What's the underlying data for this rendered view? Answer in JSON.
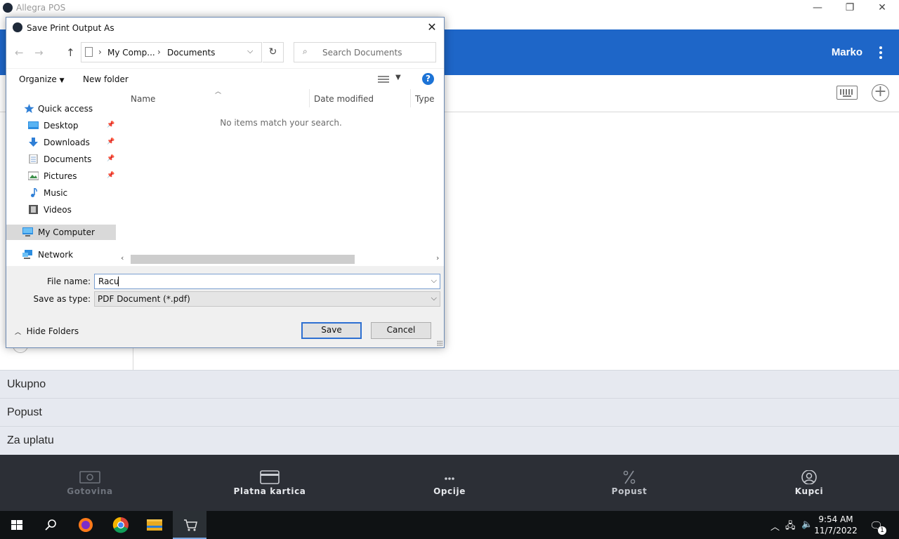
{
  "app": {
    "title": "Allegra POS",
    "user": "Marko",
    "totals": [
      {
        "label": "Ukupno"
      },
      {
        "label": "Popust"
      },
      {
        "label": "Za uplatu"
      }
    ],
    "bottom_actions": [
      {
        "label": "Gotovina",
        "icon": "cash-icon",
        "enabled": false
      },
      {
        "label": "Platna kartica",
        "icon": "card-icon",
        "enabled": true
      },
      {
        "label": "Opcije",
        "icon": "more-icon",
        "enabled": true
      },
      {
        "label": "Popust",
        "icon": "percent-icon",
        "enabled": false
      },
      {
        "label": "Kupci",
        "icon": "user-icon",
        "enabled": true
      }
    ],
    "colors": {
      "header": "#1e66c8",
      "bottom_bar": "#2c2f36",
      "totals_bg": "#e6e9f0"
    }
  },
  "dialog": {
    "title": "Save Print Output As",
    "address": {
      "segments": [
        "My Comp...",
        "Documents"
      ]
    },
    "search_placeholder": "Search Documents",
    "commands": {
      "organize": "Organize",
      "new_folder": "New folder"
    },
    "nav_tree": [
      {
        "label": "Quick access",
        "icon": "star-icon",
        "pinned": false
      },
      {
        "label": "Desktop",
        "icon": "desktop-icon",
        "pinned": true
      },
      {
        "label": "Downloads",
        "icon": "download-icon",
        "pinned": true
      },
      {
        "label": "Documents",
        "icon": "documents-icon",
        "pinned": true
      },
      {
        "label": "Pictures",
        "icon": "pictures-icon",
        "pinned": true
      },
      {
        "label": "Music",
        "icon": "music-icon",
        "pinned": false
      },
      {
        "label": "Videos",
        "icon": "videos-icon",
        "pinned": false
      },
      {
        "label": "My Computer",
        "icon": "computer-icon",
        "pinned": false,
        "selected": true
      },
      {
        "label": "Network",
        "icon": "network-icon",
        "pinned": false
      }
    ],
    "columns": [
      "Name",
      "Date modified",
      "Type"
    ],
    "empty_message": "No items match your search.",
    "file_name_label": "File name:",
    "file_name_value": "Racu",
    "save_type_label": "Save as type:",
    "save_type_value": "PDF Document (*.pdf)",
    "hide_folders": "Hide Folders",
    "save_button": "Save",
    "cancel_button": "Cancel"
  },
  "taskbar": {
    "time": "9:54 AM",
    "date": "11/7/2022",
    "notification_count": "1"
  }
}
